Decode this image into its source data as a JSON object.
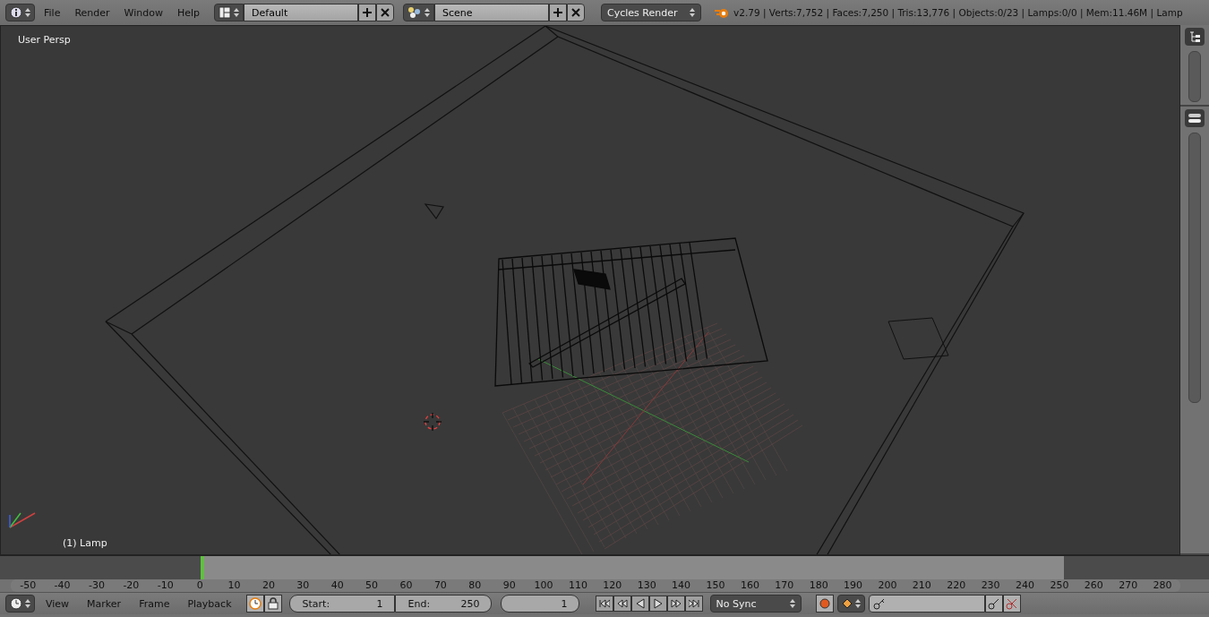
{
  "header": {
    "menus": [
      "File",
      "Render",
      "Window",
      "Help"
    ],
    "layout": "Default",
    "scene": "Scene",
    "render_engine": "Cycles Render",
    "stats": "v2.79 | Verts:7,752 | Faces:7,250 | Tris:13,776 | Objects:0/23 | Lamps:0/0 | Mem:11.46M | Lamp"
  },
  "viewport": {
    "view_label": "User Persp",
    "object_label": "(1) Lamp"
  },
  "timeline": {
    "ruler": [
      "-50",
      "-40",
      "-30",
      "-20",
      "-10",
      "0",
      "10",
      "20",
      "30",
      "40",
      "50",
      "60",
      "70",
      "80",
      "90",
      "100",
      "110",
      "120",
      "130",
      "140",
      "150",
      "160",
      "170",
      "180",
      "190",
      "200",
      "210",
      "220",
      "230",
      "240",
      "250",
      "260",
      "270",
      "280"
    ]
  },
  "footer": {
    "menus": [
      "View",
      "Marker",
      "Frame",
      "Playback"
    ],
    "start": {
      "label": "Start:",
      "value": "1"
    },
    "end": {
      "label": "End:",
      "value": "250"
    },
    "current_frame": "1",
    "sync": "No Sync"
  }
}
